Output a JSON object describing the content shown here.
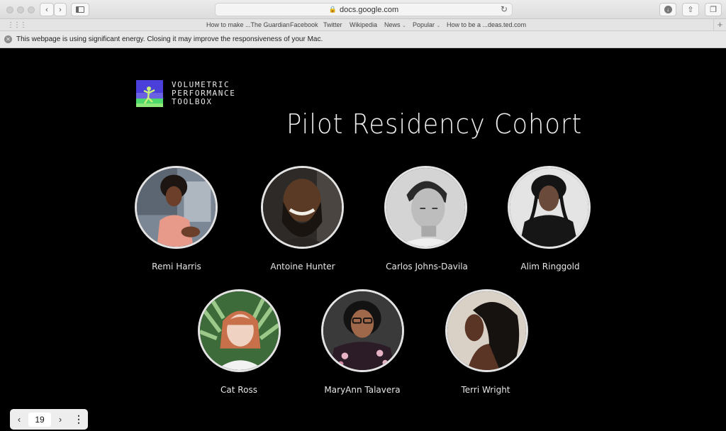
{
  "browser": {
    "url": "docs.google.com",
    "favorites": [
      "How to make ...The Guardian",
      "Facebook",
      "Twitter",
      "Wikipedia",
      "News",
      "Popular",
      "How to be a ...deas.ted.com"
    ],
    "energy_warning": "This webpage is using significant energy. Closing it may improve the responsiveness of your Mac."
  },
  "slide": {
    "logo_lines": [
      "VOLUMETRIC",
      "PERFORMANCE",
      "TOOLBOX"
    ],
    "title": "Pilot Residency Cohort",
    "people": [
      "Remi Harris",
      "Antoine Hunter",
      "Carlos Johns-Davila",
      "Alim Ringgold",
      "Cat Ross",
      "MaryAnn Talavera",
      "Terri Wright"
    ]
  },
  "pager": {
    "page": "19",
    "prev_icon": "chevron-left-icon",
    "next_icon": "chevron-right-icon",
    "menu_icon": "more-vertical-icon"
  }
}
